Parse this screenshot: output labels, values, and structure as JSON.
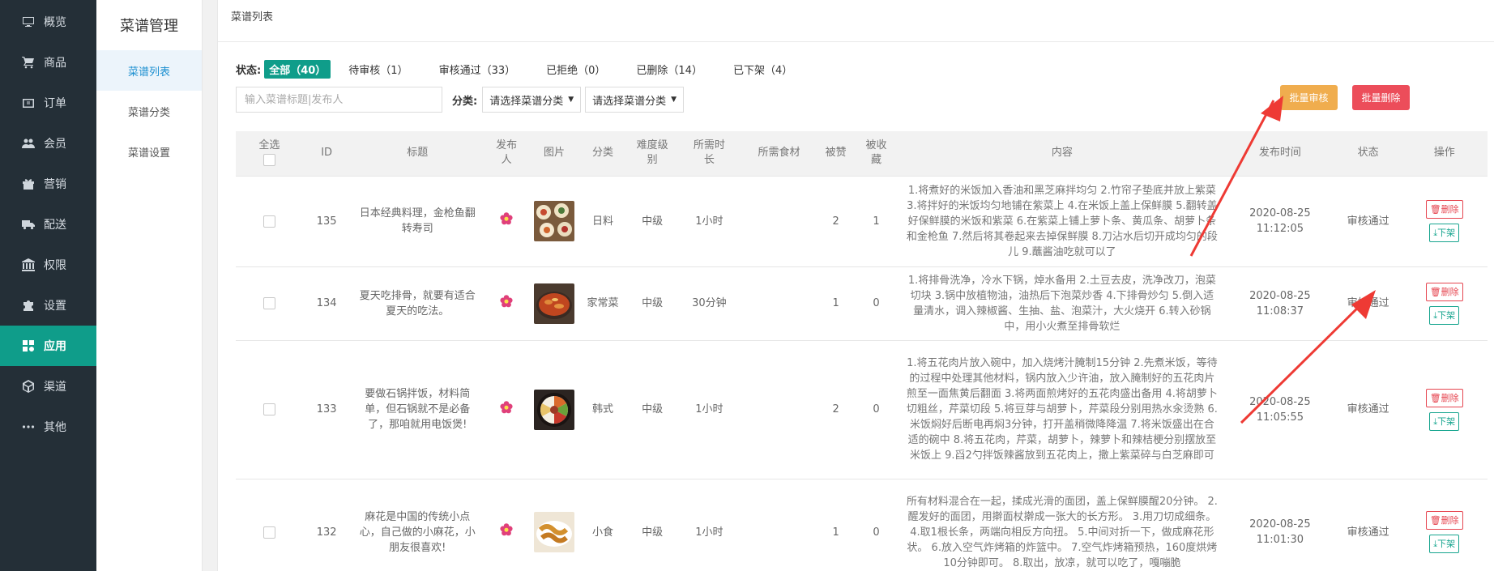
{
  "sidebar": {
    "items": [
      {
        "label": "概览",
        "icon": "monitor-icon"
      },
      {
        "label": "商品",
        "icon": "cart-icon"
      },
      {
        "label": "订单",
        "icon": "order-icon"
      },
      {
        "label": "会员",
        "icon": "users-icon"
      },
      {
        "label": "营销",
        "icon": "gift-icon"
      },
      {
        "label": "配送",
        "icon": "truck-icon"
      },
      {
        "label": "权限",
        "icon": "bank-icon"
      },
      {
        "label": "设置",
        "icon": "puzzle-icon"
      },
      {
        "label": "应用",
        "icon": "apps-icon",
        "active": true
      },
      {
        "label": "渠道",
        "icon": "cube-icon"
      },
      {
        "label": "其他",
        "icon": "more-icon"
      }
    ]
  },
  "submenu": {
    "title": "菜谱管理",
    "items": [
      "菜谱列表",
      "菜谱分类",
      "菜谱设置"
    ]
  },
  "page": {
    "title": "菜谱列表"
  },
  "status": {
    "label": "状态:",
    "items": [
      "全部（40）",
      "待审核（1）",
      "审核通过（33）",
      "已拒绝（0）",
      "已删除（14）",
      "已下架（4）"
    ]
  },
  "filters": {
    "search_placeholder": "输入菜谱标题|发布人",
    "category_label": "分类:",
    "select1": "请选择菜谱分类",
    "select2": "请选择菜谱分类"
  },
  "buttons": {
    "batch_audit": "批量审核",
    "batch_delete": "批量删除"
  },
  "table": {
    "headers": [
      "全选",
      "ID",
      "标题",
      "发布人",
      "图片",
      "分类",
      "难度级别",
      "所需时长",
      "所需食材",
      "被赞",
      "被收藏",
      "内容",
      "发布时间",
      "状态",
      "操作"
    ],
    "delete_label": "删除",
    "offline_label": "下架",
    "rows": [
      {
        "id": "135",
        "title": "日本经典料理，金枪鱼翻转寿司",
        "category": "日料",
        "level": "中级",
        "duration": "1小时",
        "ingredients": "",
        "likes": "2",
        "favorites": "1",
        "content": "1.将煮好的米饭加入香油和黑芝麻拌均匀 2.竹帘子垫底并放上紫菜 3.将拌好的米饭均匀地铺在紫菜上 4.在米饭上盖上保鲜膜 5.翻转盖好保鲜膜的米饭和紫菜 6.在紫菜上铺上萝卜条、黄瓜条、胡萝卜条和金枪鱼 7.然后将其卷起来去掉保鲜膜 8.刀沾水后切开成均匀的段儿 9.蘸酱油吃就可以了",
        "date": "2020-08-25",
        "time": "11:12:05",
        "status": "审核通过"
      },
      {
        "id": "134",
        "title": "夏天吃排骨，就要有适合夏天的吃法。",
        "category": "家常菜",
        "level": "中级",
        "duration": "30分钟",
        "ingredients": "",
        "likes": "1",
        "favorites": "0",
        "content": "1.将排骨洗净，冷水下锅，焯水备用 2.土豆去皮，洗净改刀，泡菜切块 3.锅中放植物油，油热后下泡菜炒香 4.下排骨炒匀 5.倒入适量清水，调入辣椒酱、生抽、盐、泡菜汁，大火烧开 6.转入砂锅中，用小火煮至排骨软烂",
        "date": "2020-08-25",
        "time": "11:08:37",
        "status": "审核通过"
      },
      {
        "id": "133",
        "title": "要做石锅拌饭，材料简单，但石锅就不是必备了，那咱就用电饭煲!",
        "category": "韩式",
        "level": "中级",
        "duration": "1小时",
        "ingredients": "",
        "likes": "2",
        "favorites": "0",
        "content": "1.将五花肉片放入碗中，加入烧烤汁腌制15分钟 2.先煮米饭，等待的过程中处理其他材料，锅内放入少许油，放入腌制好的五花肉片煎至一面焦黄后翻面 3.将两面煎烤好的五花肉盛出备用 4.将胡萝卜切粗丝，芹菜切段 5.将豆芽与胡萝卜，芹菜段分别用热水汆烫熟 6.米饭焖好后断电再焖3分钟，打开盖稍微降降温 7.将米饭盛出在合适的碗中 8.将五花肉，芹菜，胡萝卜，辣萝卜和辣桔梗分别摆放至米饭上 9.舀2勺拌饭辣酱放到五花肉上，撒上紫菜碎与白芝麻即可",
        "date": "2020-08-25",
        "time": "11:05:55",
        "status": "审核通过"
      },
      {
        "id": "132",
        "title": "麻花是中国的传统小点心，自己做的小麻花，小朋友很喜欢!",
        "category": "小食",
        "level": "中级",
        "duration": "1小时",
        "ingredients": "",
        "likes": "1",
        "favorites": "0",
        "content": "所有材料混合在一起，揉成光滑的面团，盖上保鲜膜醒20分钟。 2.醒发好的面团，用擀面杖擀成一张大的长方形。 3.用刀切成细条。 4.取1根长条，两端向相反方向扭。 5.中间对折一下，做成麻花形状。 6.放入空气炸烤箱的炸篮中。 7.空气炸烤箱预热，160度烘烤10分钟即可。 8.取出，放凉，就可以吃了，嘎嘣脆",
        "date": "2020-08-25",
        "time": "11:01:30",
        "status": "审核通过"
      }
    ]
  },
  "colors": {
    "sidebar_bg": "#242f37",
    "accent": "#0f9d8a",
    "audit_btn": "#f0ad4e",
    "delete_btn": "#ec4d5a",
    "arrow": "#ee3a34"
  }
}
